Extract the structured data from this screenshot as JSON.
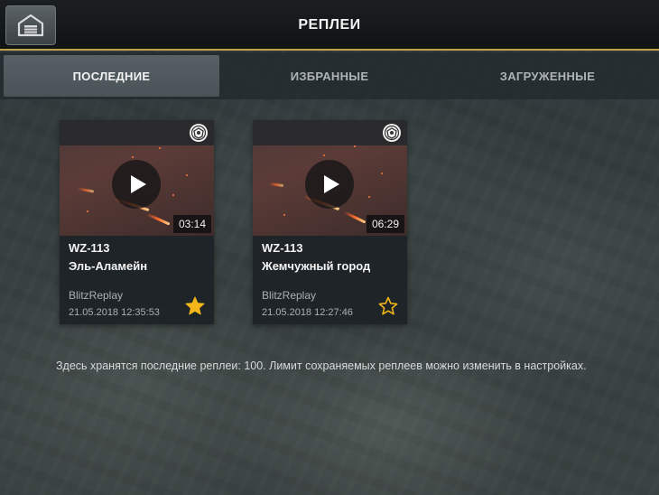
{
  "header": {
    "title": "РЕПЛЕИ",
    "home_icon": "hangar-icon",
    "accent_color": "#c0a24a"
  },
  "tabs": [
    {
      "label": "ПОСЛЕДНИЕ",
      "active": true
    },
    {
      "label": "ИЗБРАННЫЕ",
      "active": false
    },
    {
      "label": "ЗАГРУЖЕННЫЕ",
      "active": false
    }
  ],
  "replays": [
    {
      "tank": "WZ-113",
      "map": "Эль-Аламейн",
      "player": "BlitzReplay",
      "date": "21.05.2018 12:35:53",
      "duration": "03:14",
      "favorite": true,
      "star_icon": "star-filled-icon"
    },
    {
      "tank": "WZ-113",
      "map": "Жемчужный город",
      "player": "BlitzReplay",
      "date": "21.05.2018 12:27:46",
      "duration": "06:29",
      "favorite": false,
      "star_icon": "star-outline-icon"
    }
  ],
  "info_text": "Здесь хранятся последние реплеи: 100. Лимит сохраняемых реплеев можно изменить в настройках.",
  "colors": {
    "star": "#f2b618",
    "tab_active_bg": "#566066"
  }
}
